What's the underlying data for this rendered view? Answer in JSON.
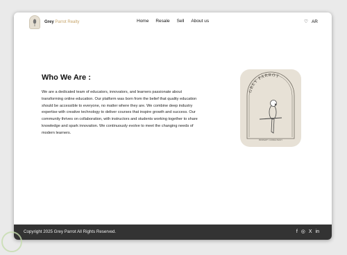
{
  "brand": {
    "name": "Grey",
    "accent": "Parrot Realty"
  },
  "nav": {
    "items": [
      "Home",
      "Resale",
      "Sell",
      "About us"
    ]
  },
  "tools": {
    "heart": "♡",
    "language": "AR"
  },
  "about": {
    "heading": "Who We Are :",
    "body": "We are a dedicated team of educators, innovators, and learners passionate about transforming online education. Our platform was born from the belief that quality education should be accessible to everyone, no matter where they are. We combine deep industry expertise with creative technology to deliver courses that inspire growth and success. Our community thrives on collaboration, with instructors and students working together to share knowledge and spark innovation. We continuously evolve to meet the changing needs of modern learners."
  },
  "card": {
    "arch_text": "GREY PARROT",
    "bottom_text": "PROPERTY CONSULTANCY"
  },
  "footer": {
    "copyright": "Copyright 2025 Grey Parrot All Rights Reserved."
  },
  "social": [
    "facebook-icon",
    "instagram-icon",
    "x-icon",
    "linkedin-icon"
  ],
  "colors": {
    "accent": "#c7a56a",
    "footer": "#333333",
    "card": "#e7e1d6"
  }
}
